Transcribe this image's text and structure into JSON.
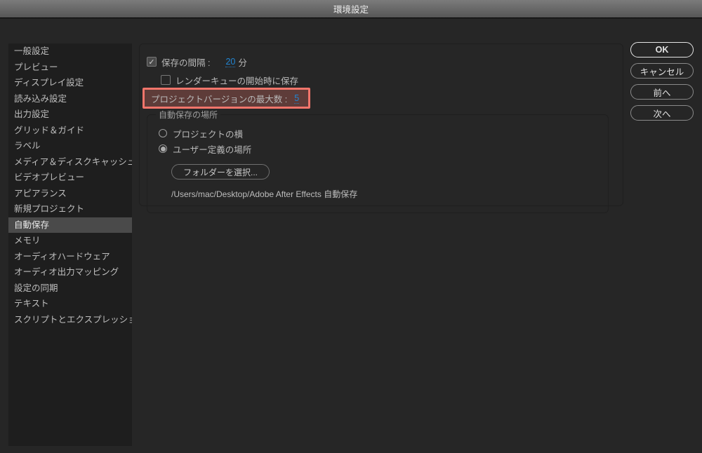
{
  "title": "環境設定",
  "sidebar": {
    "items": [
      "一般設定",
      "プレビュー",
      "ディスプレイ設定",
      "読み込み設定",
      "出力設定",
      "グリッド＆ガイド",
      "ラベル",
      "メディア＆ディスクキャッシュ",
      "ビデオプレビュー",
      "アピアランス",
      "新規プロジェクト",
      "自動保存",
      "メモリ",
      "オーディオハードウェア",
      "オーディオ出力マッピング",
      "設定の同期",
      "テキスト",
      "スクリプトとエクスプレッション"
    ],
    "active_index": 11
  },
  "buttons": {
    "ok": "OK",
    "cancel": "キャンセル",
    "prev": "前へ",
    "next": "次へ"
  },
  "main": {
    "save_interval_label": "保存の間隔 :",
    "save_interval_value": "20",
    "save_interval_unit": "分",
    "save_on_render_start": "レンダーキューの開始時に保存",
    "max_versions_label": "プロジェクトバージョンの最大数 :",
    "max_versions_value": "5",
    "group_legend": "自動保存の場所",
    "radio_next_to": "プロジェクトの横",
    "radio_custom": "ユーザー定義の場所",
    "choose_folder": "フォルダーを選択...",
    "path": "/Users/mac/Desktop/Adobe After Effects 自動保存"
  }
}
